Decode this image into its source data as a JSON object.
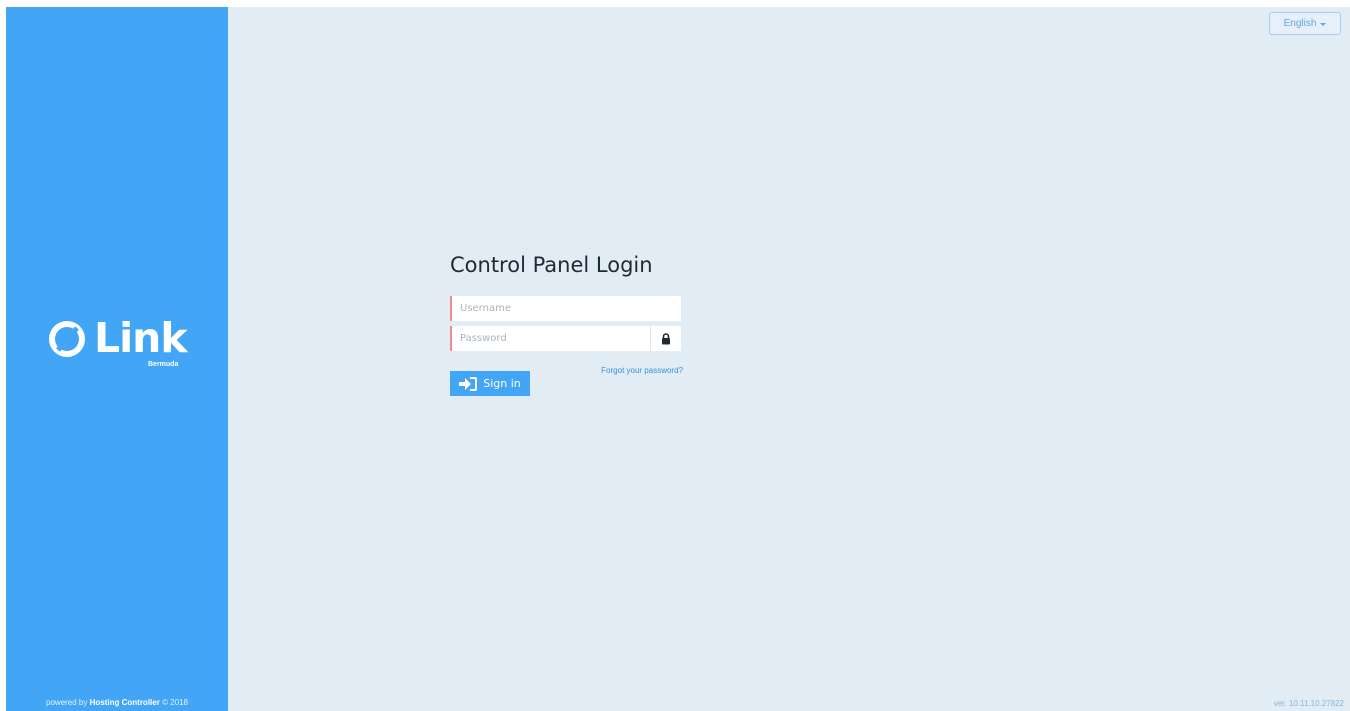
{
  "sidebar": {
    "logo_text": "Link",
    "logo_subtext": "Bermuda",
    "footer_prefix": "powered by",
    "footer_brand": "Hosting Controller",
    "footer_suffix": "© 2018"
  },
  "header": {
    "language_label": "English"
  },
  "login": {
    "title": "Control Panel Login",
    "username_placeholder": "Username",
    "password_placeholder": "Password",
    "forgot_label": "Forgot your password?",
    "signin_label": "Sign in"
  },
  "footer": {
    "version": "ver. 10.11.10.27822"
  },
  "colors": {
    "sidebar": "#42a5f5",
    "background": "#e1ecf5",
    "accent": "#42a5f5",
    "invalid_field_border": "#f08a8a"
  },
  "icons": {
    "logo": "link-logo-icon",
    "lock": "lock-icon",
    "signin": "sign-in-icon",
    "language_caret": "caret-down-icon"
  }
}
